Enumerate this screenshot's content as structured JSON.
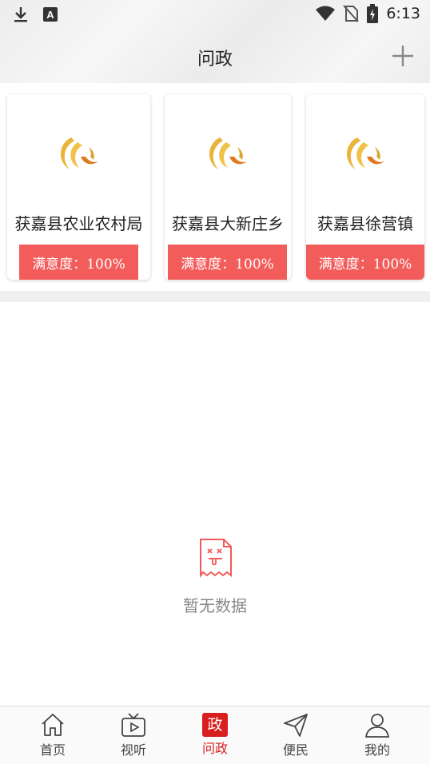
{
  "status_bar": {
    "time": "6:13",
    "left_icons": [
      "download-icon",
      "a-badge-icon"
    ],
    "right_icons": [
      "wifi-icon",
      "no-sim-icon",
      "battery-charging-icon"
    ]
  },
  "header": {
    "title": "问政",
    "add_icon": "plus-icon"
  },
  "cards": [
    {
      "name": "获嘉县农业农村局",
      "satisfaction": "满意度：100%"
    },
    {
      "name": "获嘉县大新庄乡",
      "satisfaction": "满意度：100%"
    },
    {
      "name": "获嘉县徐营镇",
      "satisfaction": "满意度：100%"
    }
  ],
  "empty_state": {
    "icon": "empty-document-icon",
    "text": "暂无数据"
  },
  "bottom_nav": {
    "items": [
      {
        "label": "首页",
        "icon": "home-icon"
      },
      {
        "label": "视听",
        "icon": "tv-icon"
      },
      {
        "label": "问政",
        "icon_text": "政",
        "active": true
      },
      {
        "label": "便民",
        "icon": "send-icon"
      },
      {
        "label": "我的",
        "icon": "user-icon"
      }
    ]
  },
  "colors": {
    "accent_red": "#d81e1e",
    "badge_red": "#f25d5b",
    "logo_gold": "#e8b43a"
  }
}
